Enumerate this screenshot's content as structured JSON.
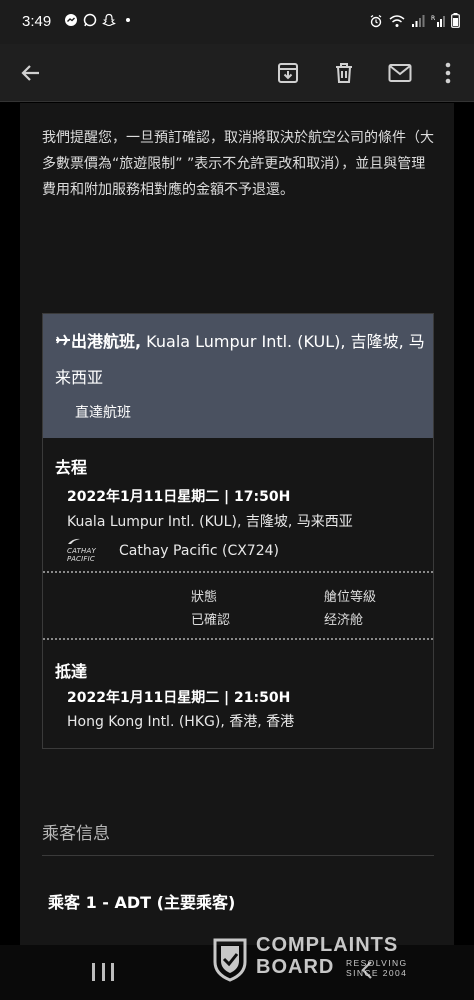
{
  "status_bar": {
    "time": "3:49"
  },
  "icons": {
    "back": "arrow-left-icon",
    "archive": "archive-icon",
    "delete": "trash-icon",
    "mark_unread": "mail-icon",
    "more": "more-vert-icon"
  },
  "notice": "我們提醒您，一旦預訂確認，取消將取決於航空公司的條件（大多數票價為“旅遊限制” ”表示不允許更改和取消），並且與管理費用和附加服務相對應的金額不予退還。",
  "flight": {
    "title_bold": "出港航班,",
    "title_rest": " Kuala Lumpur Intl. (KUL), 吉隆坡, 马来西亚",
    "direct": "直達航班",
    "departure": {
      "label": "去程",
      "datetime": "2022年1月11日星期二 | 17:50H",
      "airport": "Kuala Lumpur Intl. (KUL), 吉隆坡, 马来西亚",
      "airline_logo": "CATHAY PACIFIC",
      "airline": "Cathay Pacific (CX724)"
    },
    "status_label": "狀態",
    "status_value": "已確認",
    "cabin_label": "艙位等級",
    "cabin_value": "经济舱",
    "arrival": {
      "label": "抵達",
      "datetime": "2022年1月11日星期二 | 21:50H",
      "airport": "Hong Kong Intl. (HKG), 香港, 香港"
    }
  },
  "passengers": {
    "header": "乘客信息",
    "first": "乘客 1 - ADT (主要乘客)"
  },
  "watermark": {
    "line1": "COMPLAINTS",
    "line2": "BOARD",
    "tag1": "RESOLVING",
    "tag2": "SINCE 2004"
  }
}
